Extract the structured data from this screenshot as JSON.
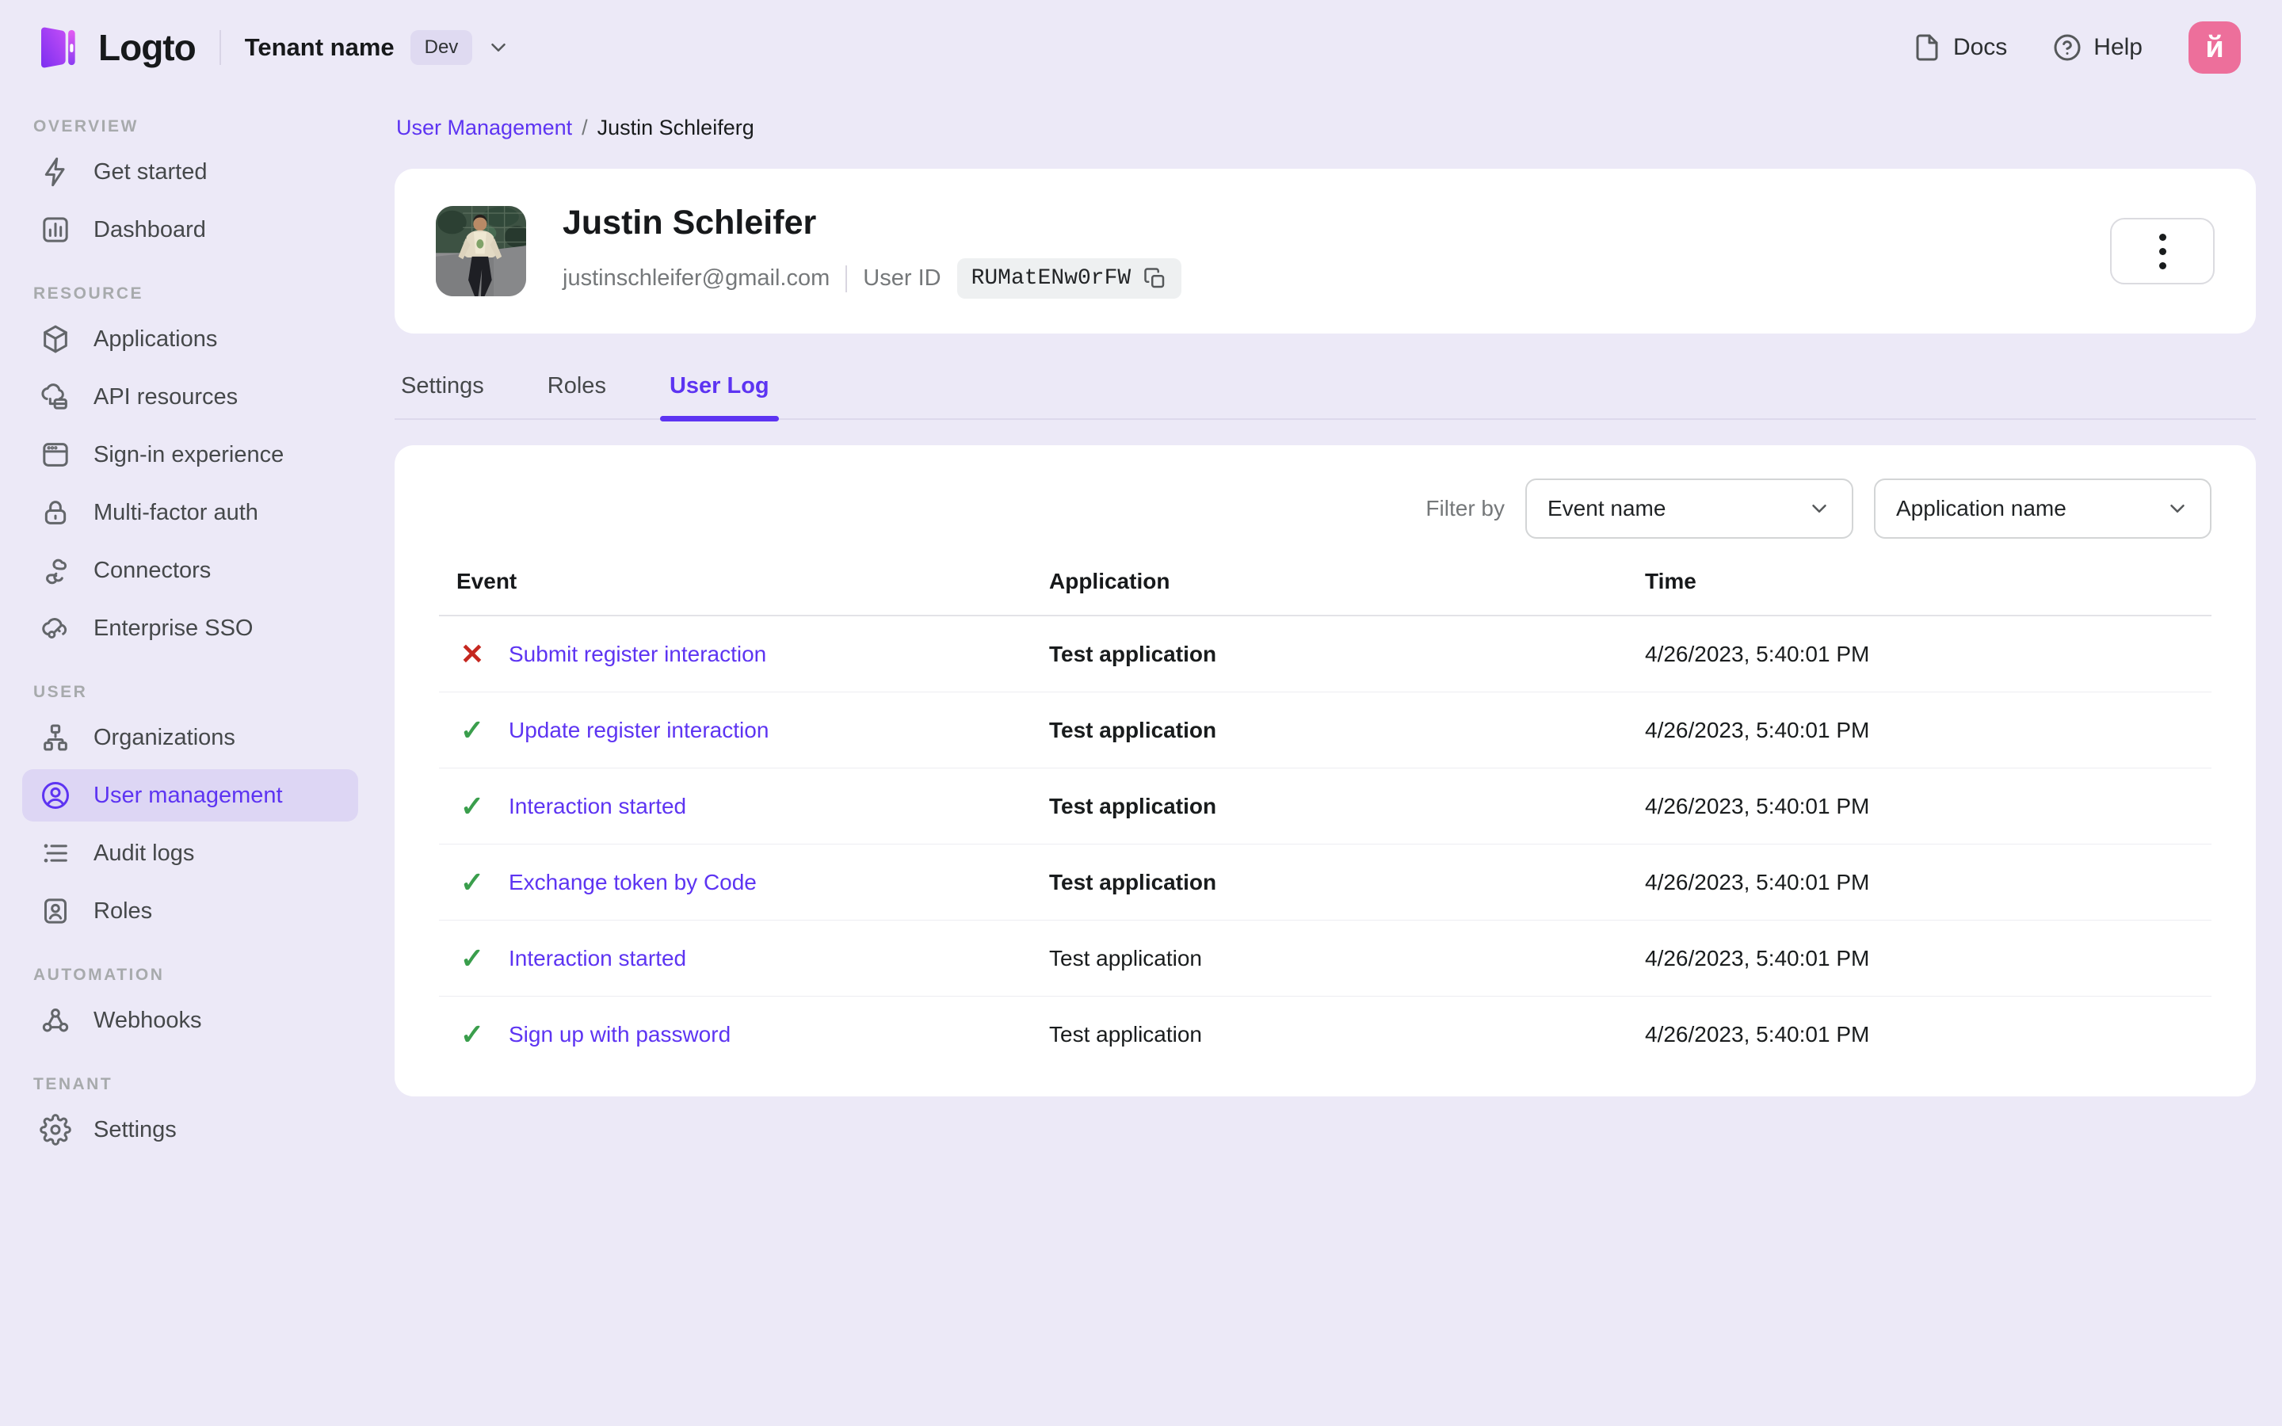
{
  "topbar": {
    "logo_text": "Logto",
    "tenant_name": "Tenant name",
    "tenant_badge": "Dev",
    "docs_label": "Docs",
    "help_label": "Help",
    "avatar_initial": "й"
  },
  "sidebar": {
    "sections": [
      {
        "title": "Overview",
        "items": [
          {
            "label": "Get started"
          },
          {
            "label": "Dashboard"
          }
        ]
      },
      {
        "title": "Resource",
        "items": [
          {
            "label": "Applications"
          },
          {
            "label": "API resources"
          },
          {
            "label": "Sign-in experience"
          },
          {
            "label": "Multi-factor auth"
          },
          {
            "label": "Connectors"
          },
          {
            "label": "Enterprise SSO"
          }
        ]
      },
      {
        "title": "User",
        "items": [
          {
            "label": "Organizations"
          },
          {
            "label": "User management"
          },
          {
            "label": "Audit logs"
          },
          {
            "label": "Roles"
          }
        ]
      },
      {
        "title": "Automation",
        "items": [
          {
            "label": "Webhooks"
          }
        ]
      },
      {
        "title": "Tenant",
        "items": [
          {
            "label": "Settings"
          }
        ]
      }
    ]
  },
  "breadcrumb": {
    "parent": "User Management",
    "separator": "/",
    "current": "Justin Schleiferg"
  },
  "user_card": {
    "name": "Justin Schleifer",
    "email": "justinschleifer@gmail.com",
    "user_id_label": "User ID",
    "user_id": "RUMatENw0rFW"
  },
  "tabs": [
    {
      "label": "Settings"
    },
    {
      "label": "Roles"
    },
    {
      "label": "User Log"
    }
  ],
  "filters": {
    "label": "Filter by",
    "event_filter": "Event name",
    "application_filter": "Application name"
  },
  "table": {
    "columns": [
      "Event",
      "Application",
      "Time"
    ],
    "rows": [
      {
        "status_icon": "✕",
        "status": "error",
        "event": "Submit register interaction",
        "application": "Test application",
        "time": "4/26/2023, 5:40:01 PM"
      },
      {
        "status_icon": "✓",
        "status": "success",
        "event": "Update register interaction",
        "application": "Test application",
        "time": "4/26/2023, 5:40:01 PM"
      },
      {
        "status_icon": "✓",
        "status": "success",
        "event": "Interaction started",
        "application": "Test application",
        "time": "4/26/2023, 5:40:01 PM"
      },
      {
        "status_icon": "✓",
        "status": "success",
        "event": "Exchange token by Code",
        "application": "Test application",
        "time": "4/26/2023, 5:40:01 PM"
      },
      {
        "status_icon": "✓",
        "status": "success",
        "event": "Interaction started",
        "application": "Test application",
        "time": "4/26/2023, 5:40:01 PM"
      },
      {
        "status_icon": "✓",
        "status": "success",
        "event": "Sign up with password",
        "application": "Test application",
        "time": "4/26/2023, 5:40:01 PM"
      }
    ]
  },
  "colors": {
    "accent": "#5d34f2",
    "active_item_bg": "#ddd6f4",
    "success": "#3a9e4c",
    "error": "#c5271f",
    "avatar_bg": "#ed6f9b"
  }
}
